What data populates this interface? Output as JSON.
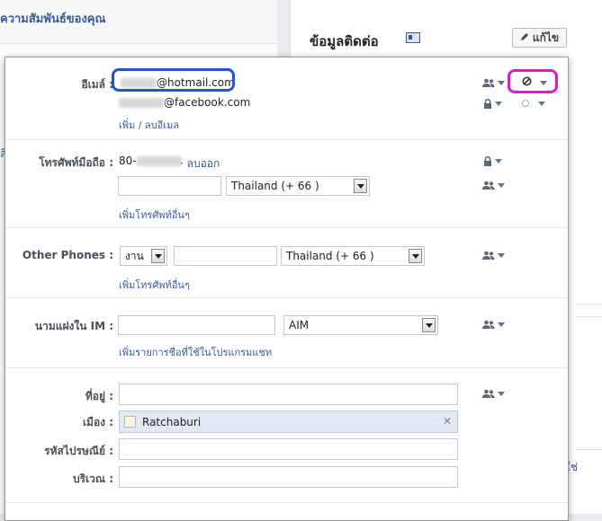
{
  "background": {
    "left_heading": "ความสัมพันธ์ของคุณ",
    "left_link": "ลิ",
    "right_title": "ข้อมูลติดต่อ",
    "edit_button": "แก้ไข",
    "right_link": "ใช่"
  },
  "email": {
    "label": "อีเมล์ :",
    "primary_suffix": "@hotmail.com",
    "secondary_suffix": "@facebook.com",
    "add_remove_link": "เพิ่ม / ลบอีเมล"
  },
  "mobile": {
    "label": "โทรศัพท์มือถือ :",
    "number_prefix": "80-",
    "remove_link": "· ลบออก",
    "input_value": "",
    "country_select": "Thailand (+ 66 )",
    "add_other_link": "เพิ่มโทรศัพท์อื่นๆ"
  },
  "other_phones": {
    "label": "Other Phones :",
    "type_select": "งาน",
    "input_value": "",
    "country_select": "Thailand (+ 66 )",
    "add_other_link": "เพิ่มโทรศัพท์อื่นๆ"
  },
  "im": {
    "label": "นามแฝงใน IM :",
    "input_value": "",
    "service_select": "AIM",
    "add_link": "เพิ่มรายการชื่อที่ใช้ในโปรแกรมแชท"
  },
  "address": {
    "address_label": "ที่อยู่ :",
    "address_value": "",
    "city_label": "เมือง :",
    "city_value": "Ratchaburi",
    "postal_label": "รหัสไปรษณีย์ :",
    "postal_value": "",
    "area_label": "บริเวณ :",
    "area_value": ""
  },
  "colors": {
    "link": "#3b5998",
    "highlight_blue": "#2354c9",
    "highlight_pink": "#e01acb"
  },
  "icons": {
    "audience_friends": "people-icon",
    "audience_only_me": "lock-icon",
    "audience_hidden": "block-icon",
    "edit": "pencil-icon",
    "contact_card": "contact-card-icon",
    "remove_city": "close-icon"
  }
}
